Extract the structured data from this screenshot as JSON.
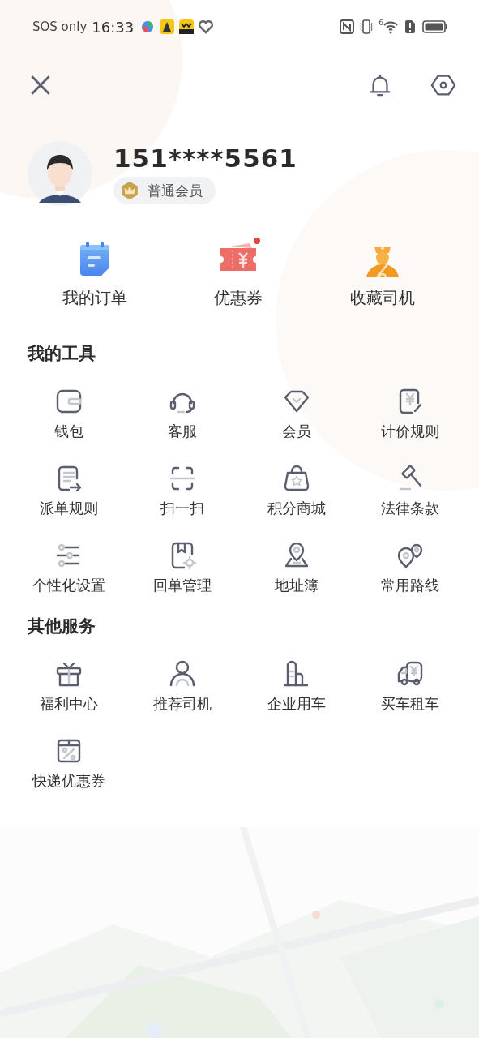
{
  "status_bar": {
    "carrier": "SOS only",
    "time": "16:33",
    "network_label": "6"
  },
  "profile": {
    "phone": "151****5561",
    "level": "普通会员"
  },
  "shortcuts": [
    {
      "label": "我的订单",
      "dot": false
    },
    {
      "label": "优惠券",
      "dot": true
    },
    {
      "label": "收藏司机",
      "dot": false
    }
  ],
  "sections": [
    {
      "title": "我的工具",
      "items": [
        {
          "label": "钱包"
        },
        {
          "label": "客服"
        },
        {
          "label": "会员"
        },
        {
          "label": "计价规则"
        },
        {
          "label": "派单规则"
        },
        {
          "label": "扫一扫"
        },
        {
          "label": "积分商城"
        },
        {
          "label": "法律条款"
        },
        {
          "label": "个性化设置"
        },
        {
          "label": "回单管理"
        },
        {
          "label": "地址簿"
        },
        {
          "label": "常用路线"
        }
      ]
    },
    {
      "title": "其他服务",
      "items": [
        {
          "label": "福利中心"
        },
        {
          "label": "推荐司机"
        },
        {
          "label": "企业用车"
        },
        {
          "label": "买车租车"
        },
        {
          "label": "快递优惠券"
        }
      ]
    }
  ]
}
